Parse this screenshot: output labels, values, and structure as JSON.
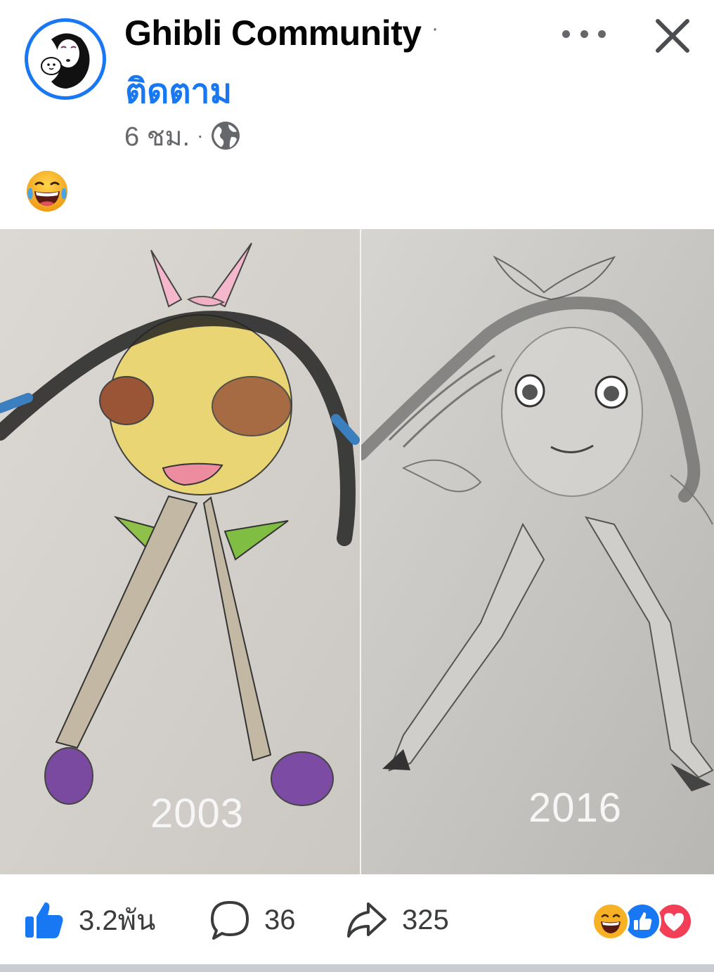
{
  "post": {
    "page_name": "Ghibli Community",
    "name_separator": "·",
    "follow_label": "ติดตาม",
    "time": "6 ชม.",
    "meta_separator": "·",
    "privacy_icon": "globe-icon",
    "body_emoji": "face-with-tears-of-joy",
    "image": {
      "left_year": "2003",
      "right_year": "2016"
    }
  },
  "actions": {
    "like_count": "3.2พัน",
    "comment_count": "36",
    "share_count": "325",
    "reactions": [
      "haha",
      "like",
      "love"
    ]
  },
  "colors": {
    "brand_blue": "#1877f2",
    "secondary_text": "#65676b",
    "love_red": "#f33e58",
    "haha_yellow": "#f7b125"
  }
}
